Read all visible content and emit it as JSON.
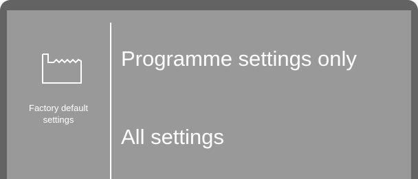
{
  "side_panel": {
    "icon": "factory-icon",
    "label_line1": "Factory default",
    "label_line2": "settings"
  },
  "options": [
    {
      "label": "Programme settings only"
    },
    {
      "label": "All settings"
    }
  ],
  "colors": {
    "bezel": "#636363",
    "screen": "#999999",
    "text": "#ffffff"
  }
}
